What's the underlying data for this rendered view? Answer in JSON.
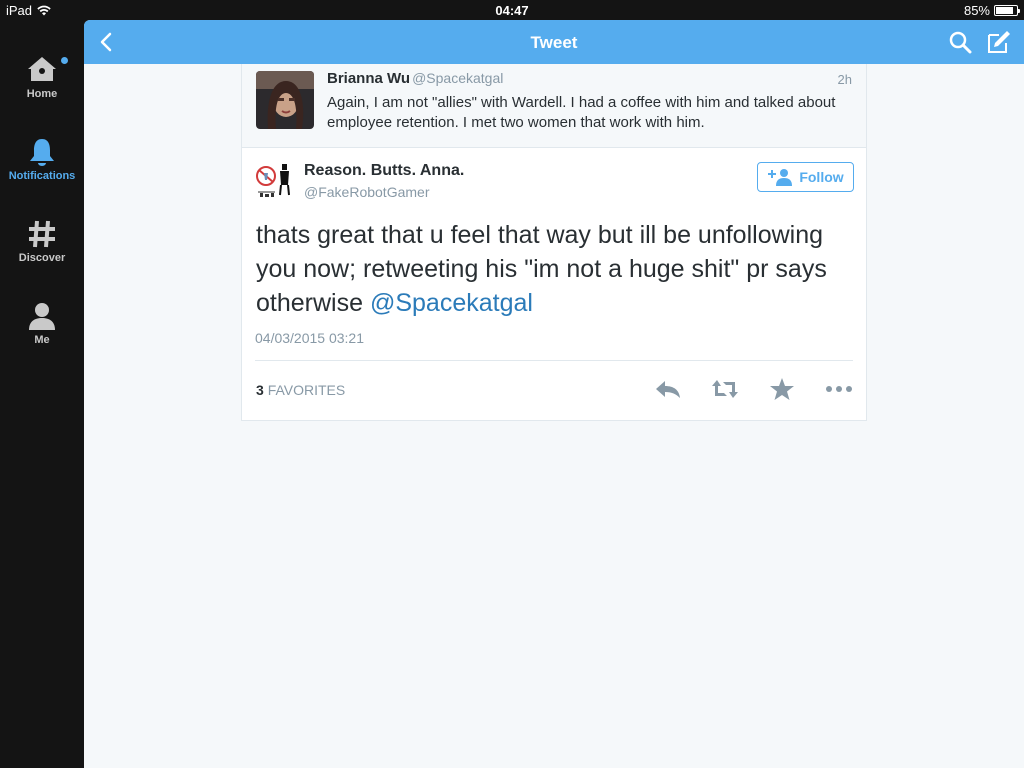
{
  "status_bar": {
    "device": "iPad",
    "time": "04:47",
    "battery": "85%",
    "battery_level": 0.85
  },
  "sidebar": {
    "items": [
      {
        "label": "Home",
        "icon": "home-icon"
      },
      {
        "label": "Notifications",
        "icon": "bell-icon",
        "active": true
      },
      {
        "label": "Discover",
        "icon": "hashtag-icon"
      },
      {
        "label": "Me",
        "icon": "person-icon"
      }
    ]
  },
  "header": {
    "title": "Tweet"
  },
  "previous_tweet": {
    "name": "Brianna Wu",
    "handle": "@Spacekatgal",
    "time": "2h",
    "text": "Again, I am not \"allies\" with Wardell. I had a coffee with him and talked about employee retention. I met two women that work with him."
  },
  "tweet": {
    "name": "Reason. Butts. Anna.",
    "handle": "@FakeRobotGamer",
    "follow_label": "Follow",
    "body": "thats great that u feel that way but ill be unfollowing you now; retweeting his \"im not a huge shit\" pr says otherwise",
    "mention": "@Spacekatgal",
    "date": "04/03/2015 03:21",
    "favorites_count": "3",
    "favorites_label": "FAVORITES"
  },
  "colors": {
    "accent": "#55acee",
    "link": "#2b7bb9",
    "sidebar_bg": "#141414",
    "muted": "#8899a6"
  }
}
